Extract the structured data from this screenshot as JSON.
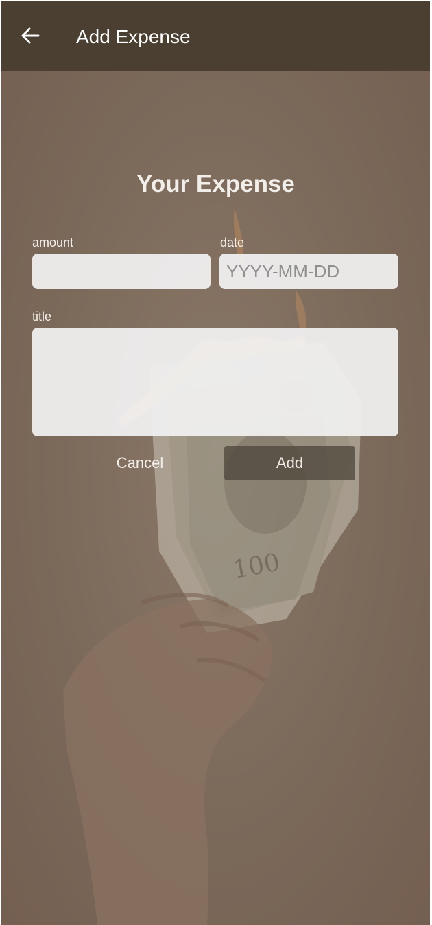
{
  "app_bar": {
    "title": "Add Expense",
    "back_icon": "arrow-left-icon",
    "background_color": "#4a3f30"
  },
  "form": {
    "heading": "Your Expense",
    "amount": {
      "label": "amount",
      "value": "",
      "placeholder": ""
    },
    "date": {
      "label": "date",
      "value": "",
      "placeholder": "YYYY-MM-DD"
    },
    "title": {
      "label": "title",
      "value": "",
      "placeholder": ""
    },
    "cancel_label": "Cancel",
    "add_label": "Add"
  },
  "background": {
    "description_icon": "burning-money-photo",
    "tint_color": "#7c6a5b"
  }
}
